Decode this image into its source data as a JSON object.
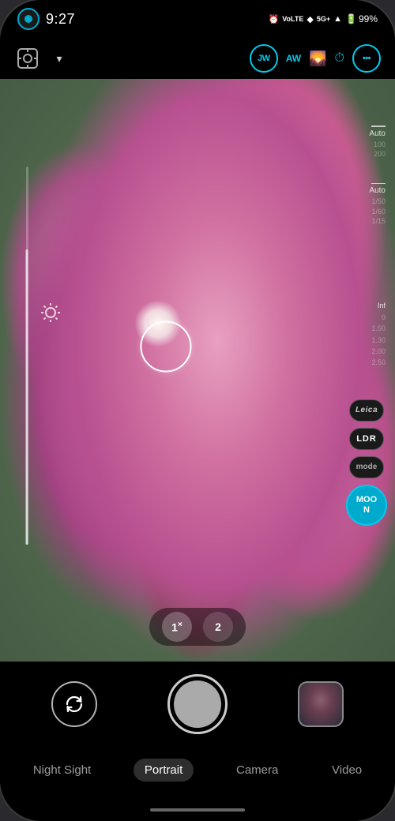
{
  "status_bar": {
    "time": "9:27",
    "battery_percent": "99%",
    "icons": {
      "alarm": "⏰",
      "volte": "VoLTE",
      "wifi": "▲",
      "fiveg": "5G+",
      "signal": "▲",
      "battery": "▮"
    }
  },
  "camera_controls": {
    "settings_label": "⚙",
    "chevron": "▾",
    "modes": [
      {
        "id": "jw",
        "label": "JW"
      },
      {
        "id": "aw",
        "label": "AW"
      },
      {
        "id": "scene",
        "label": "≈"
      },
      {
        "id": "timer",
        "label": "⏱"
      },
      {
        "id": "more",
        "label": "⊕"
      }
    ]
  },
  "viewfinder": {
    "iso": {
      "label": "Auto",
      "values": [
        "100",
        "200"
      ]
    },
    "shutter": {
      "label": "Auto",
      "values": [
        "1/50",
        "1/60",
        "1/15"
      ]
    },
    "focus_distances": [
      "Inf",
      "0",
      "1.50",
      "1.30",
      "2.00",
      "2.50"
    ]
  },
  "side_buttons": {
    "leica_label": "Leica",
    "ldr_label": "LDR",
    "mode_label": "mode",
    "moon_label": "MOO\nN"
  },
  "zoom": {
    "options": [
      {
        "label": "1×",
        "active": true
      },
      {
        "label": "2",
        "active": false
      }
    ]
  },
  "bottom_controls": {
    "rotate_title": "Switch Camera",
    "shutter_title": "Take Photo",
    "gallery_title": "Gallery"
  },
  "mode_tabs": [
    {
      "label": "Night Sight",
      "active": false
    },
    {
      "label": "Portrait",
      "active": true
    },
    {
      "label": "Camera",
      "active": false
    },
    {
      "label": "Video",
      "active": false
    }
  ]
}
